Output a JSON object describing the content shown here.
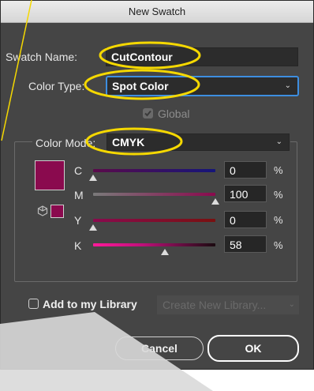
{
  "dialog": {
    "title": "New Swatch"
  },
  "swatch_name": {
    "label": "Swatch Name:",
    "value": "CutContour"
  },
  "color_type": {
    "label": "Color Type:",
    "value": "Spot Color"
  },
  "global": {
    "label": "Global",
    "checked": true
  },
  "color_mode": {
    "label": "Color Mode:",
    "value": "CMYK"
  },
  "sliders": [
    {
      "label": "C",
      "value": "0",
      "unit": "%",
      "fraction": 0.0
    },
    {
      "label": "M",
      "value": "100",
      "unit": "%",
      "fraction": 1.0
    },
    {
      "label": "Y",
      "value": "0",
      "unit": "%",
      "fraction": 0.0
    },
    {
      "label": "K",
      "value": "58",
      "unit": "%",
      "fraction": 0.58
    }
  ],
  "library": {
    "label": "Add to my Library",
    "select_placeholder": "Create New Library...",
    "checked": false
  },
  "buttons": {
    "cancel": "Cancel",
    "ok": "OK"
  },
  "colors": {
    "swatch": "#8a0a4e",
    "highlight": "#f5d800",
    "focus": "#3d8ee0"
  }
}
